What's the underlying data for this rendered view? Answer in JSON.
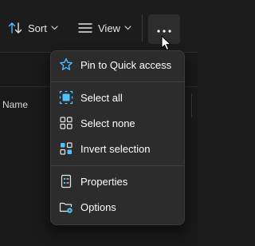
{
  "toolbar": {
    "sort_label": "Sort",
    "view_label": "View",
    "sort_icon": "sort-arrows-icon",
    "view_icon": "view-lines-icon",
    "more_icon": "more-ellipsis-icon"
  },
  "file_list": {
    "name_header": "Name"
  },
  "menu": {
    "items": [
      {
        "label": "Pin to Quick access",
        "icon": "pin-star-icon"
      },
      {
        "label": "Select all",
        "icon": "select-all-icon"
      },
      {
        "label": "Select none",
        "icon": "select-none-icon"
      },
      {
        "label": "Invert selection",
        "icon": "invert-selection-icon"
      },
      {
        "label": "Properties",
        "icon": "properties-icon"
      },
      {
        "label": "Options",
        "icon": "options-icon"
      }
    ]
  },
  "colors": {
    "accent": "#4cc2ff",
    "menu_background": "#2c2c2c",
    "window_background": "#1c1c1c",
    "text": "#ffffff"
  }
}
